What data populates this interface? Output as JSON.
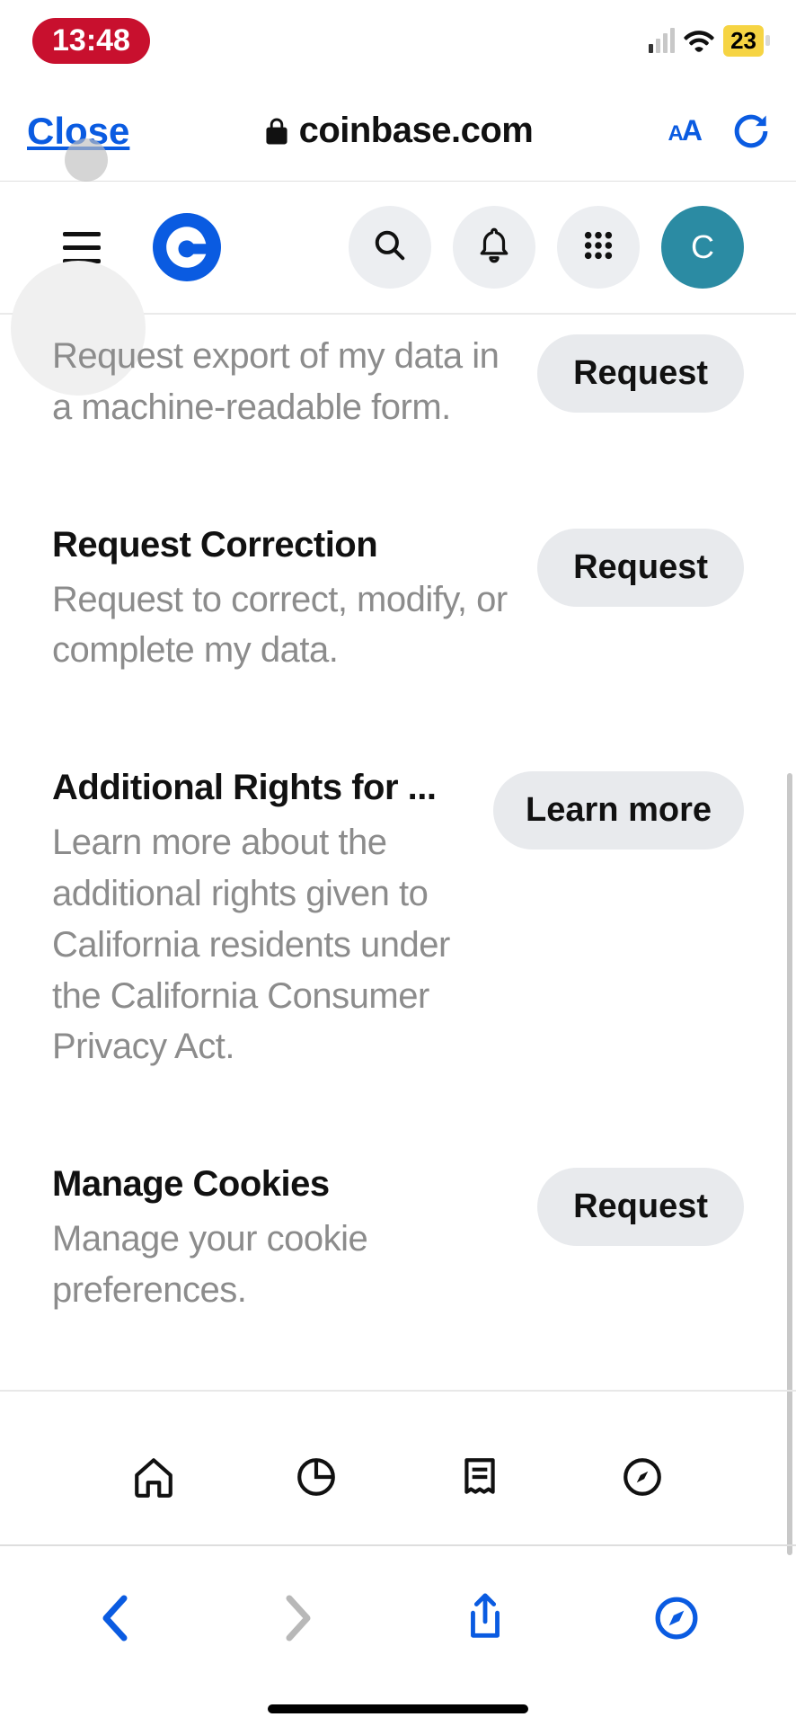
{
  "status": {
    "time": "13:48",
    "battery": "23"
  },
  "browser": {
    "close": "Close",
    "url": "coinbase.com",
    "aa_small": "A",
    "aa_large": "A"
  },
  "header": {
    "avatar_initial": "C"
  },
  "items": [
    {
      "title": "",
      "desc": "Request export of my data in a machine-readable form.",
      "action": "Request"
    },
    {
      "title": "Request Correction",
      "desc": "Request to correct, modify, or complete my data.",
      "action": "Request"
    },
    {
      "title": "Additional Rights for ...",
      "desc": "Learn more about the additional rights given to California residents under the California Consumer Privacy Act.",
      "action": "Learn more"
    },
    {
      "title": "Manage Cookies",
      "desc": "Manage your cookie preferences.",
      "action": "Request"
    }
  ]
}
